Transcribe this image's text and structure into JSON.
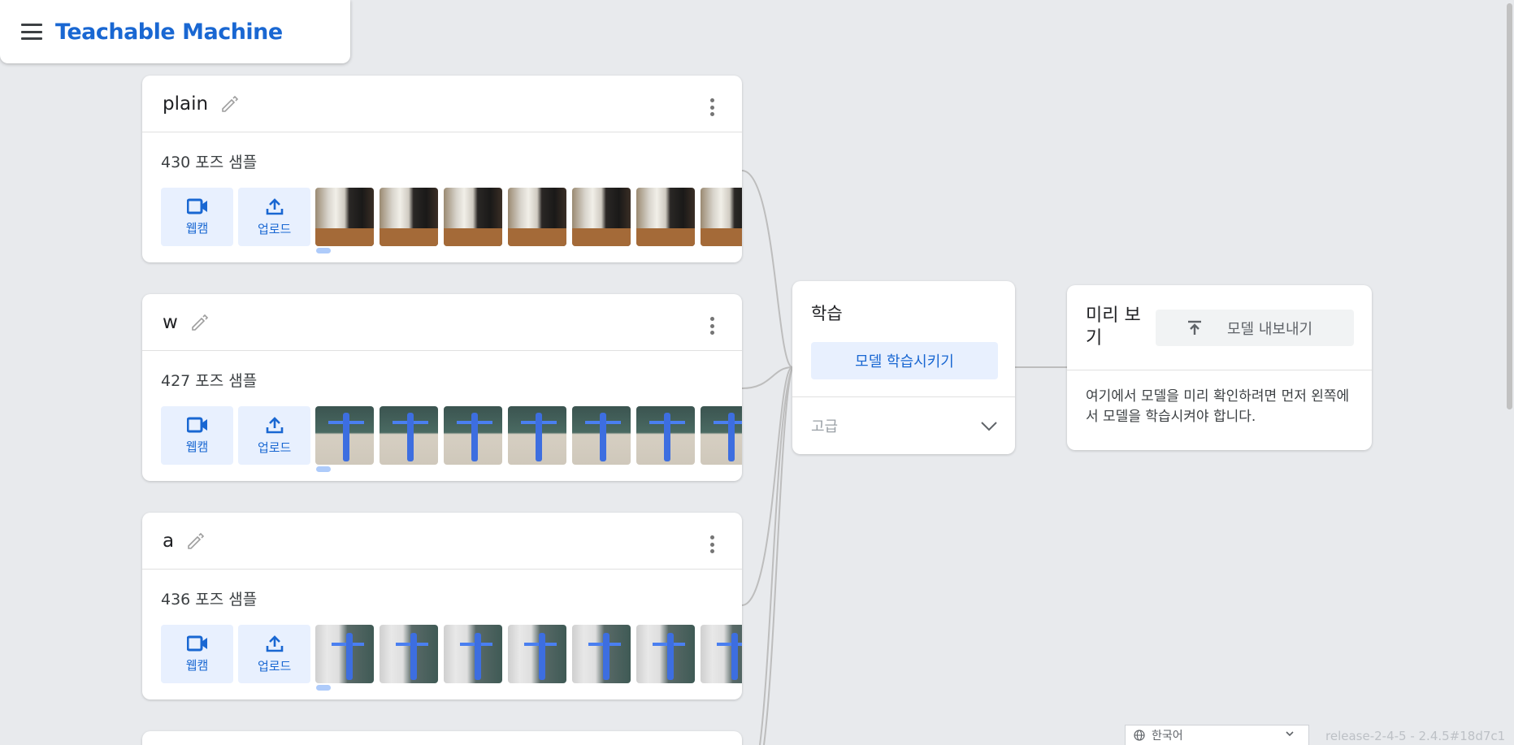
{
  "header": {
    "title": "Teachable Machine"
  },
  "classes": [
    {
      "name": "plain",
      "sample_count": "430 포즈 샘플",
      "webcam_label": "웹캠",
      "upload_label": "업로드",
      "thumb_style": "room"
    },
    {
      "name": "w",
      "sample_count": "427 포즈 샘플",
      "webcam_label": "웹캠",
      "upload_label": "업로드",
      "thumb_style": "board"
    },
    {
      "name": "a",
      "sample_count": "436 포즈 샘플",
      "webcam_label": "웹캠",
      "upload_label": "업로드",
      "thumb_style": "wall"
    }
  ],
  "training": {
    "title": "학습",
    "train_button": "모델 학습시키기",
    "advanced_label": "고급"
  },
  "preview": {
    "title": "미리 보기",
    "export_button": "모델 내보내기",
    "message": "여기에서 모델을 미리 확인하려면 먼저 왼쪽에서 모델을 학습시켜야 합니다."
  },
  "footer": {
    "language": "한국어",
    "version": "release-2-4-5 - 2.4.5#18d7c1"
  },
  "colors": {
    "accent": "#1967d2",
    "accent_light": "#e8f0fe",
    "background": "#e8eaed"
  },
  "icons": [
    "menu-icon",
    "edit-icon",
    "more-vert-icon",
    "webcam-icon",
    "upload-icon",
    "chevron-down-icon",
    "export-icon",
    "globe-icon"
  ]
}
